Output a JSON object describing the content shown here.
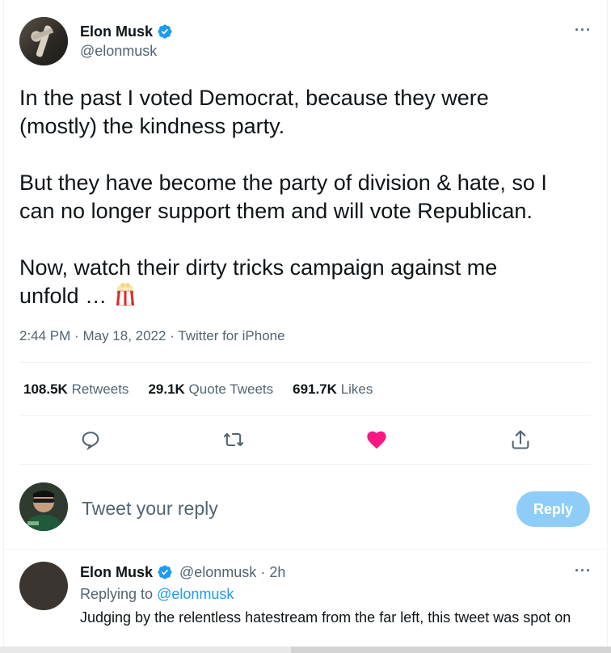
{
  "tweet": {
    "author_name": "Elon Musk",
    "author_handle": "@elonmusk",
    "text": "In the past I voted Democrat, because they were\n(mostly) the kindness party.\n\nBut they have become the party of division & hate, so I\ncan no longer support them and will vote Republican.\n\nNow, watch their dirty tricks campaign against me\nunfold …",
    "emoji_icon": "popcorn-icon",
    "time": "2:44 PM",
    "date": "May 18, 2022",
    "source": "Twitter for iPhone",
    "separator": "·"
  },
  "stats": {
    "retweets_count": "108.5K",
    "retweets_label": "Retweets",
    "quotes_count": "29.1K",
    "quotes_label": "Quote Tweets",
    "likes_count": "691.7K",
    "likes_label": "Likes"
  },
  "actions": {
    "icons": [
      "reply-icon",
      "retweet-icon",
      "like-icon",
      "share-icon"
    ],
    "liked_color": "#f91880"
  },
  "composer": {
    "placeholder": "Tweet your reply",
    "button_label": "Reply",
    "button_color": "#8ecdf8"
  },
  "reply": {
    "author_name": "Elon Musk",
    "author_handle": "@elonmusk",
    "time_ago": "2h",
    "replying_to_label": "Replying to",
    "replying_to_handle": "@elonmusk",
    "text": "Judging by the relentless hatestream from the far left, this tweet was spot on"
  },
  "colors": {
    "verified": "#1d9bf0",
    "secondary_text": "#536471",
    "link": "#1d9bf0"
  },
  "more_label": "···"
}
